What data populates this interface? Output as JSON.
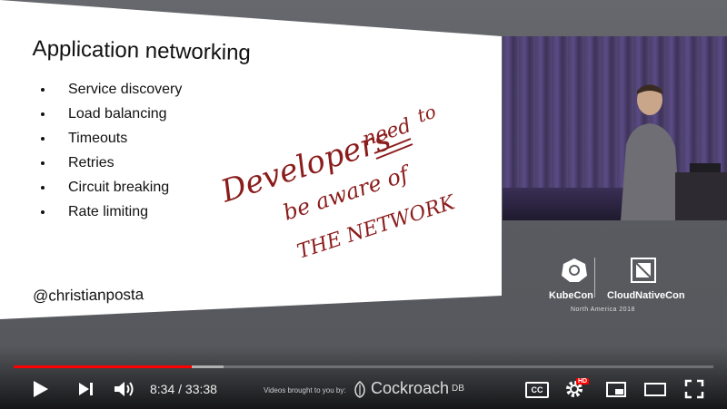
{
  "slide": {
    "title": "Application networking",
    "bullets": [
      "Service discovery",
      "Load balancing",
      "Timeouts",
      "Retries",
      "Circuit breaking",
      "Rate limiting"
    ],
    "handle": "@christianposta",
    "annotation": [
      "Developers",
      "need",
      "to",
      "be aware of",
      "THE NETWORK"
    ]
  },
  "event": {
    "kubecon": "KubeCon",
    "cncf": "CloudNativeCon",
    "subtitle": "North America 2018"
  },
  "player": {
    "current_time": "8:34",
    "separator": "/",
    "duration": "33:38",
    "played_fraction": 0.254,
    "buffered_fraction": 0.3,
    "sponsor_text": "Videos brought to you by:",
    "sponsor_brand": "Cockroach",
    "sponsor_brand_suffix": "DB",
    "cc_label": "CC",
    "hd_badge": "HD",
    "accent_color": "#ff0000"
  },
  "icons": {
    "play": "play-icon",
    "next": "next-icon",
    "volume": "volume-icon",
    "subtitles": "subtitles-icon",
    "settings": "gear-icon",
    "miniplayer": "miniplayer-icon",
    "theater": "theater-mode-icon",
    "fullscreen": "fullscreen-icon"
  }
}
